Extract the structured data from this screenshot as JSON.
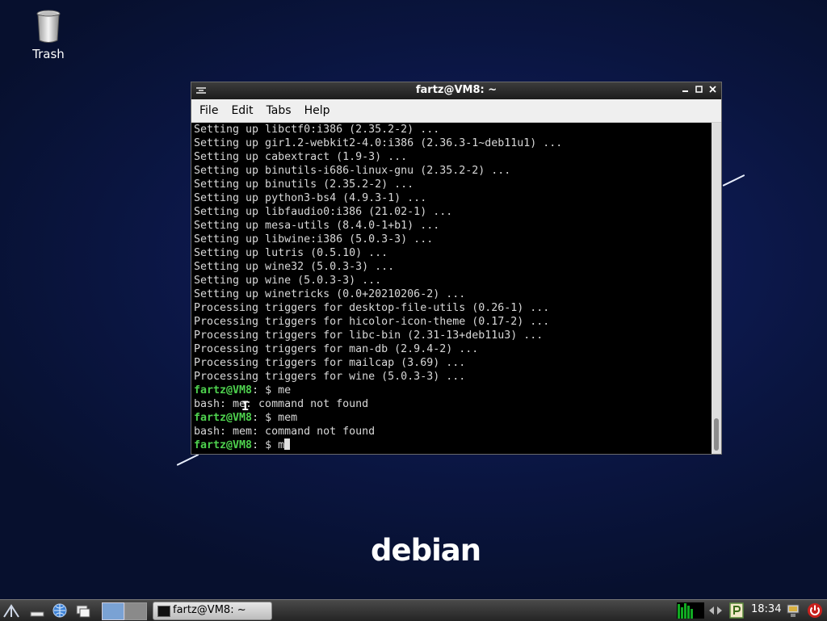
{
  "desktop": {
    "trash_label": "Trash",
    "wallpaper_logo": "debian"
  },
  "terminal": {
    "title": "fartz@VM8: ~",
    "menu": [
      "File",
      "Edit",
      "Tabs",
      "Help"
    ],
    "lines": [
      {
        "type": "out",
        "text": "Setting up libctf0:i386 (2.35.2-2) ..."
      },
      {
        "type": "out",
        "text": "Setting up gir1.2-webkit2-4.0:i386 (2.36.3-1~deb11u1) ..."
      },
      {
        "type": "out",
        "text": "Setting up cabextract (1.9-3) ..."
      },
      {
        "type": "out",
        "text": "Setting up binutils-i686-linux-gnu (2.35.2-2) ..."
      },
      {
        "type": "out",
        "text": "Setting up binutils (2.35.2-2) ..."
      },
      {
        "type": "out",
        "text": "Setting up python3-bs4 (4.9.3-1) ..."
      },
      {
        "type": "out",
        "text": "Setting up libfaudio0:i386 (21.02-1) ..."
      },
      {
        "type": "out",
        "text": "Setting up mesa-utils (8.4.0-1+b1) ..."
      },
      {
        "type": "out",
        "text": "Setting up libwine:i386 (5.0.3-3) ..."
      },
      {
        "type": "out",
        "text": "Setting up lutris (0.5.10) ..."
      },
      {
        "type": "out",
        "text": "Setting up wine32 (5.0.3-3) ..."
      },
      {
        "type": "out",
        "text": "Setting up wine (5.0.3-3) ..."
      },
      {
        "type": "out",
        "text": "Setting up winetricks (0.0+20210206-2) ..."
      },
      {
        "type": "out",
        "text": "Processing triggers for desktop-file-utils (0.26-1) ..."
      },
      {
        "type": "out",
        "text": "Processing triggers for hicolor-icon-theme (0.17-2) ..."
      },
      {
        "type": "out",
        "text": "Processing triggers for libc-bin (2.31-13+deb11u3) ..."
      },
      {
        "type": "out",
        "text": "Processing triggers for man-db (2.9.4-2) ..."
      },
      {
        "type": "out",
        "text": "Processing triggers for mailcap (3.69) ..."
      },
      {
        "type": "out",
        "text": "Processing triggers for wine (5.0.3-3) ..."
      },
      {
        "type": "prompt",
        "prompt": "fartz@VM8",
        "rest": ": $ me"
      },
      {
        "type": "out",
        "text": "bash: me: command not found"
      },
      {
        "type": "prompt",
        "prompt": "fartz@VM8",
        "rest": ": $ mem"
      },
      {
        "type": "out",
        "text": "bash: mem: command not found"
      },
      {
        "type": "prompt",
        "prompt": "fartz@VM8",
        "rest": ": $ m",
        "cursor": true
      }
    ]
  },
  "taskbar": {
    "task_label": "fartz@VM8: ~",
    "clock": "18:34"
  },
  "colors": {
    "prompt": "#4ed24e",
    "terminal_text": "#d8d8d8",
    "terminal_bg": "#000000",
    "debian_red": "#d70751"
  },
  "icons": [
    "trash-icon",
    "start-menu-icon",
    "show-desktop-icon",
    "browser-icon",
    "file-manager-icon",
    "workspace-1-icon",
    "workspace-2-icon",
    "terminal-icon",
    "cpu-monitor-icon",
    "network-icon",
    "volume-icon",
    "clipboard-icon",
    "network-status-icon",
    "power-icon"
  ]
}
